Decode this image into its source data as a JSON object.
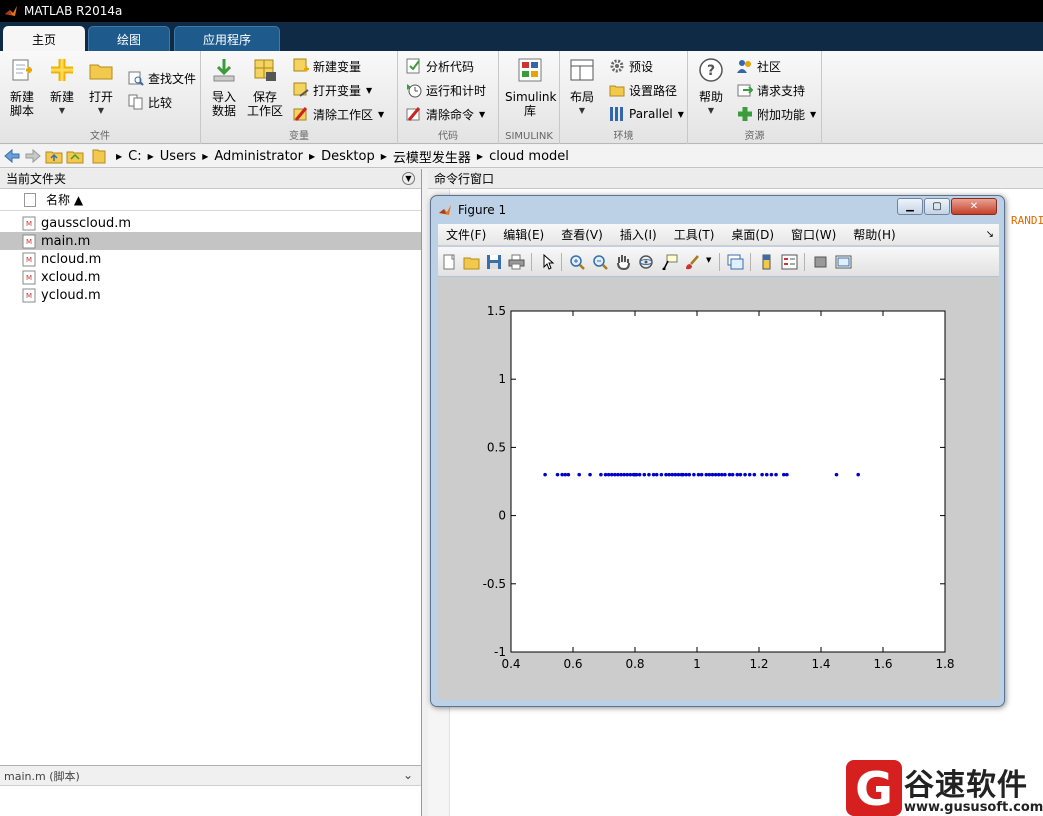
{
  "window": {
    "title": "MATLAB R2014a"
  },
  "tabs": [
    {
      "label": "主页",
      "active": true
    },
    {
      "label": "绘图",
      "active": false
    },
    {
      "label": "应用程序",
      "active": false
    }
  ],
  "ribbon": {
    "file": {
      "group": "文件",
      "new_script": "新建\n脚本",
      "new": "新建",
      "open": "打开",
      "find_files": "查找文件",
      "compare": "比较"
    },
    "variable": {
      "group": "变量",
      "import": "导入\n数据",
      "save_ws": "保存\n工作区",
      "new_var": "新建变量",
      "open_var": "打开变量",
      "clear_ws": "清除工作区"
    },
    "code": {
      "group": "代码",
      "analyze": "分析代码",
      "run_time": "运行和计时",
      "clear_cmd": "清除命令"
    },
    "simulink": {
      "group": "SIMULINK",
      "lib": "Simulink\n库"
    },
    "env": {
      "group": "环境",
      "layout": "布局",
      "prefs": "预设",
      "set_path": "设置路径",
      "parallel": "Parallel"
    },
    "resources": {
      "group": "资源",
      "help": "帮助",
      "community": "社区",
      "support": "请求支持",
      "addons": "附加功能"
    }
  },
  "path": [
    "C:",
    "Users",
    "Administrator",
    "Desktop",
    "云模型发生器",
    "cloud model"
  ],
  "current_folder": {
    "title": "当前文件夹",
    "column_name": "名称 ▲",
    "files": [
      {
        "name": "gausscloud.m",
        "selected": false
      },
      {
        "name": "main.m",
        "selected": true
      },
      {
        "name": "ncloud.m",
        "selected": false
      },
      {
        "name": "xcloud.m",
        "selected": false
      },
      {
        "name": "ycloud.m",
        "selected": false
      }
    ],
    "details_label": "main.m (脚本)"
  },
  "command_window": {
    "title": "命令行窗口",
    "overflow_text": "RANDI"
  },
  "figure": {
    "title": "Figure 1",
    "menu": [
      "文件(F)",
      "编辑(E)",
      "查看(V)",
      "插入(I)",
      "工具(T)",
      "桌面(D)",
      "窗口(W)",
      "帮助(H)"
    ],
    "menu_overflow": "↘"
  },
  "chart_data": {
    "type": "scatter",
    "title": "",
    "xlabel": "",
    "ylabel": "",
    "xlim": [
      0.4,
      1.8
    ],
    "ylim": [
      -1,
      1.5
    ],
    "xticks": [
      0.4,
      0.6,
      0.8,
      1,
      1.2,
      1.4,
      1.6,
      1.8
    ],
    "yticks": [
      -1,
      -0.5,
      0,
      0.5,
      1,
      1.5
    ],
    "xtick_labels": [
      "0.4",
      "0.6",
      "0.8",
      "1",
      "1.2",
      "1.4",
      "1.6",
      "1.8"
    ],
    "ytick_labels": [
      "-1",
      "-0.5",
      "0",
      "0.5",
      "1",
      "1.5"
    ],
    "grid": false,
    "color": "#0000cc",
    "marker": "point",
    "x": [
      0.51,
      0.55,
      0.565,
      0.575,
      0.585,
      0.62,
      0.655,
      0.69,
      0.705,
      0.715,
      0.725,
      0.735,
      0.745,
      0.755,
      0.765,
      0.775,
      0.785,
      0.795,
      0.8,
      0.805,
      0.815,
      0.83,
      0.845,
      0.86,
      0.87,
      0.885,
      0.9,
      0.91,
      0.92,
      0.93,
      0.94,
      0.95,
      0.955,
      0.965,
      0.975,
      0.99,
      1.005,
      1.015,
      1.03,
      1.04,
      1.05,
      1.06,
      1.07,
      1.08,
      1.09,
      1.105,
      1.115,
      1.13,
      1.14,
      1.155,
      1.17,
      1.185,
      1.21,
      1.225,
      1.24,
      1.255,
      1.28,
      1.29,
      1.45,
      1.52
    ],
    "y": [
      0.3,
      0.3,
      0.3,
      0.3,
      0.3,
      0.3,
      0.3,
      0.3,
      0.3,
      0.3,
      0.3,
      0.3,
      0.3,
      0.3,
      0.3,
      0.3,
      0.3,
      0.3,
      0.3,
      0.3,
      0.3,
      0.3,
      0.3,
      0.3,
      0.3,
      0.3,
      0.3,
      0.3,
      0.3,
      0.3,
      0.3,
      0.3,
      0.3,
      0.3,
      0.3,
      0.3,
      0.3,
      0.3,
      0.3,
      0.3,
      0.3,
      0.3,
      0.3,
      0.3,
      0.3,
      0.3,
      0.3,
      0.3,
      0.3,
      0.3,
      0.3,
      0.3,
      0.3,
      0.3,
      0.3,
      0.3,
      0.3,
      0.3,
      0.3,
      0.3
    ]
  },
  "watermark": {
    "text": "谷速软件",
    "url": "www.gususoft.com",
    "logo_letter": "G"
  },
  "colors": {
    "ribbon_tab_bg": "#0e2a45",
    "accent": "#1e5b8c",
    "watermark_red": "#d61f1f",
    "points": "#0000cc"
  }
}
